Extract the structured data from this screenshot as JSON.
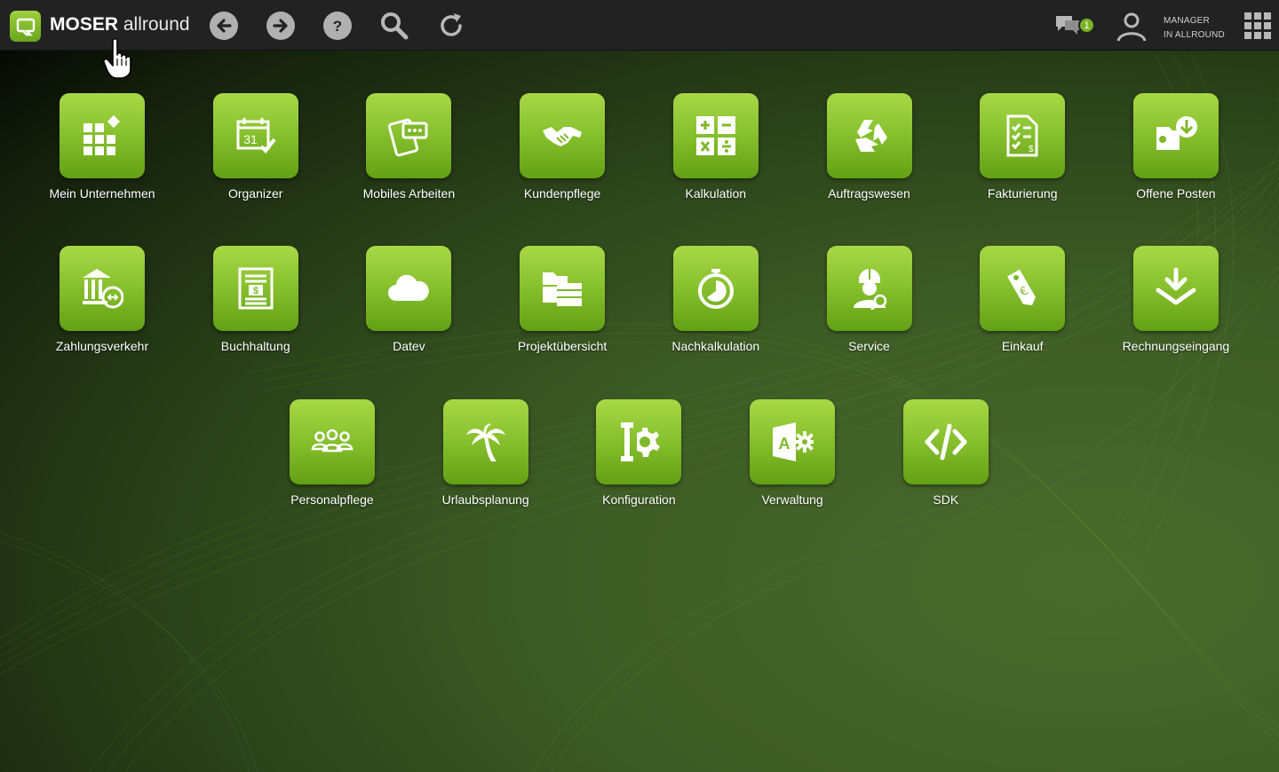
{
  "header": {
    "brand_bold": "MOSER",
    "brand_light": "allround",
    "chat_badge_count": "1",
    "user_line1": "MANAGER",
    "user_line2": "IN ALLROUND",
    "nav_icons": [
      "back-arrow-icon",
      "forward-arrow-icon",
      "help-icon",
      "search-icon",
      "refresh-icon"
    ]
  },
  "tiles": [
    {
      "label": "Mein Unternehmen",
      "icon": "grid-diamond-icon"
    },
    {
      "label": "Organizer",
      "icon": "calendar-icon"
    },
    {
      "label": "Mobiles Arbeiten",
      "icon": "tablet-chat-icon"
    },
    {
      "label": "Kundenpflege",
      "icon": "handshake-icon"
    },
    {
      "label": "Kalkulation",
      "icon": "calculator-icon"
    },
    {
      "label": "Auftragswesen",
      "icon": "recycle-arrows-icon"
    },
    {
      "label": "Fakturierung",
      "icon": "invoice-checklist-icon"
    },
    {
      "label": "Offene Posten",
      "icon": "folder-download-icon"
    },
    {
      "label": "Zahlungsverkehr",
      "icon": "bank-transfer-icon"
    },
    {
      "label": "Buchhaltung",
      "icon": "ledger-dollar-icon"
    },
    {
      "label": "Datev",
      "icon": "cloud-icon"
    },
    {
      "label": "Projektübersicht",
      "icon": "folders-icon"
    },
    {
      "label": "Nachkalkulation",
      "icon": "stopwatch-icon"
    },
    {
      "label": "Service",
      "icon": "technician-icon"
    },
    {
      "label": "Einkauf",
      "icon": "price-tag-euro-icon"
    },
    {
      "label": "Rechnungseingang",
      "icon": "inbox-download-icon"
    },
    {
      "label": "Personalpflege",
      "icon": "people-group-icon"
    },
    {
      "label": "Urlaubsplanung",
      "icon": "palm-tree-icon"
    },
    {
      "label": "Konfiguration",
      "icon": "tools-gear-icon"
    },
    {
      "label": "Verwaltung",
      "icon": "access-gear-icon"
    },
    {
      "label": "SDK",
      "icon": "code-brackets-icon"
    }
  ]
}
